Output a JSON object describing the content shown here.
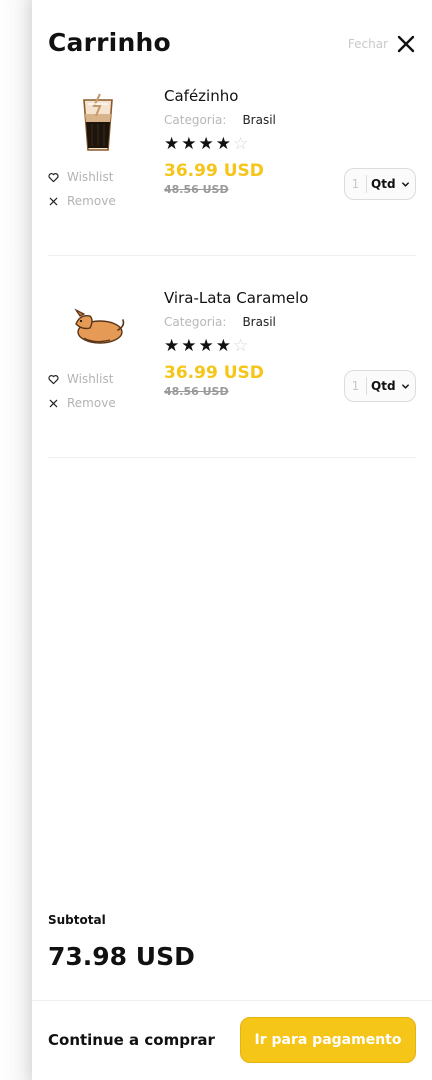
{
  "cart": {
    "title": "Carrinho",
    "close_label": "Fechar",
    "items": [
      {
        "name": "Cafézinho",
        "category_key": "Categoria:",
        "category_value": "Brasil",
        "rating": 4,
        "rating_max": 5,
        "price": "36.99 USD",
        "old_price": "48.56 USD",
        "qty_value": "1",
        "qty_label": "Qtd",
        "wishlist_label": "Wishlist",
        "remove_label": "Remove"
      },
      {
        "name": "Vira-Lata Caramelo",
        "category_key": "Categoria:",
        "category_value": "Brasil",
        "rating": 4,
        "rating_max": 5,
        "price": "36.99 USD",
        "old_price": "48.56 USD",
        "qty_value": "1",
        "qty_label": "Qtd",
        "wishlist_label": "Wishlist",
        "remove_label": "Remove"
      }
    ],
    "subtotal_label": "Subtotal",
    "subtotal_value": "73.98 USD",
    "continue_label": "Continue a comprar",
    "checkout_label": "Ir para pagamento"
  },
  "colors": {
    "accent": "#f5c518",
    "text": "#111111",
    "muted": "#b3b3b3"
  },
  "icons": {
    "close": "close-icon",
    "wishlist": "heart-icon",
    "remove": "x-icon",
    "qty": "chevron-down-icon",
    "star_full": "star-filled-icon",
    "star_empty": "star-outline-icon"
  }
}
